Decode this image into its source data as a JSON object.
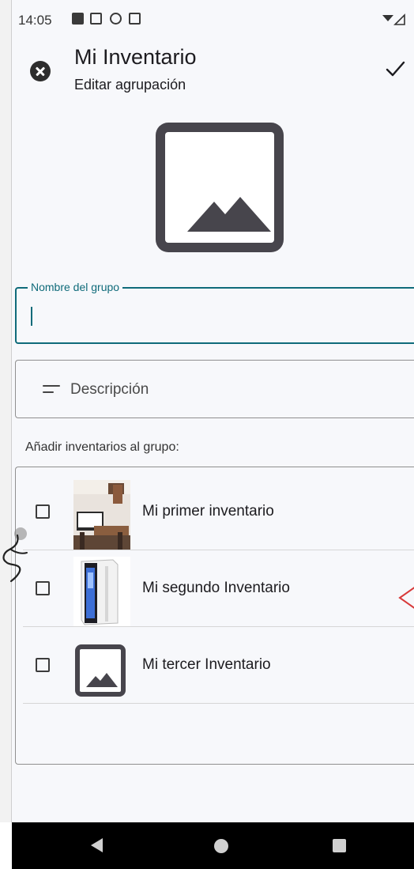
{
  "status_bar": {
    "time": "14:05"
  },
  "header": {
    "title": "Mi Inventario",
    "subtitle": "Editar agrupación"
  },
  "form": {
    "name_label": "Nombre del grupo",
    "name_value": "",
    "description_placeholder": "Descripción"
  },
  "inventories": {
    "section_label": "Añadir inventarios al grupo:",
    "items": [
      {
        "label": "Mi primer inventario",
        "checked": false,
        "thumb": "room-photo"
      },
      {
        "label": "Mi segundo Inventario",
        "checked": false,
        "thumb": "pc-case-photo"
      },
      {
        "label": "Mi tercer Inventario",
        "checked": false,
        "thumb": "image-placeholder-icon"
      }
    ]
  },
  "colors": {
    "accent": "#0f6b7a",
    "icon_dark": "#47454c",
    "background": "#f7f8fb"
  }
}
